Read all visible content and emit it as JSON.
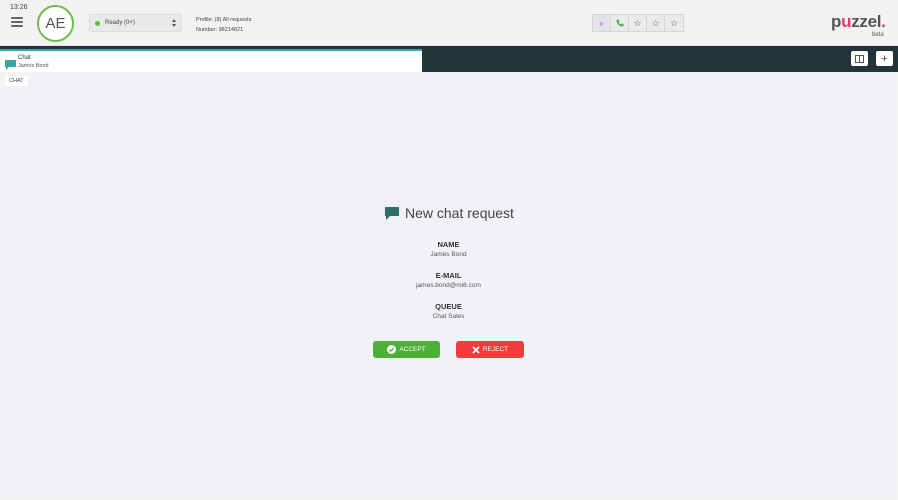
{
  "header": {
    "time": "13:26",
    "avatar_initials": "AE",
    "status": {
      "label": "Ready (0+)",
      "color": "#5ac33a"
    },
    "profile": {
      "line1": "Profile: (8) All requests",
      "line2": "Number: 98214821"
    },
    "icons": [
      "forward-icon",
      "phone-icon",
      "star-icon",
      "star-icon",
      "star-icon"
    ],
    "logo": {
      "pre": "p",
      "heart": "u",
      "post": "zzel",
      "dot": ".",
      "sub": "beta"
    }
  },
  "tabs": [
    {
      "title": "Chat",
      "subtitle": "James Bond",
      "icon": "chat-bubble-icon"
    }
  ],
  "tab_actions": {
    "columns_icon": "columns-icon",
    "add_label": "+"
  },
  "main": {
    "section_label": "CHAT",
    "title": "New chat request",
    "fields": [
      {
        "label": "NAME",
        "value": "James Bond"
      },
      {
        "label": "E-MAIL",
        "value": "james.bond@mi6.com"
      },
      {
        "label": "QUEUE",
        "value": "Chat Sales"
      }
    ],
    "accept_label": "ACCEPT",
    "reject_label": "REJECT"
  },
  "colors": {
    "accent_teal": "#37a8a0",
    "accept_green": "#4caf36",
    "reject_red": "#f23c3c",
    "dark_bar": "#223339",
    "brand_pink": "#e8336e"
  }
}
